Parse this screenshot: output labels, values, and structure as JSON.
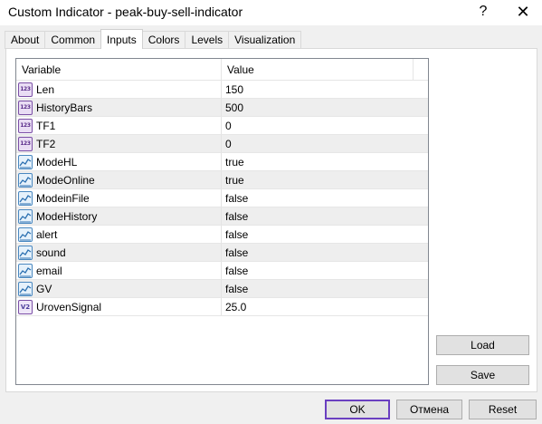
{
  "window": {
    "title": "Custom Indicator - peak-buy-sell-indicator",
    "help_glyph": "?",
    "close_glyph": "✕"
  },
  "tabs": [
    {
      "label": "About"
    },
    {
      "label": "Common"
    },
    {
      "label": "Inputs",
      "active": true
    },
    {
      "label": "Colors"
    },
    {
      "label": "Levels"
    },
    {
      "label": "Visualization"
    }
  ],
  "grid": {
    "header": {
      "variable": "Variable",
      "value": "Value"
    },
    "rows": [
      {
        "icon": "integer-icon",
        "icon_text": "123",
        "name": "Len",
        "value": "150"
      },
      {
        "icon": "integer-icon",
        "icon_text": "123",
        "name": "HistoryBars",
        "value": "500"
      },
      {
        "icon": "integer-icon",
        "icon_text": "123",
        "name": "TF1",
        "value": "0"
      },
      {
        "icon": "integer-icon",
        "icon_text": "123",
        "name": "TF2",
        "value": "0"
      },
      {
        "icon": "boolean-icon",
        "name": "ModeHL",
        "value": "true"
      },
      {
        "icon": "boolean-icon",
        "name": "ModeOnline",
        "value": "true"
      },
      {
        "icon": "boolean-icon",
        "name": "ModeinFile",
        "value": "false"
      },
      {
        "icon": "boolean-icon",
        "name": "ModeHistory",
        "value": "false"
      },
      {
        "icon": "boolean-icon",
        "name": "alert",
        "value": "false"
      },
      {
        "icon": "boolean-icon",
        "name": "sound",
        "value": "false"
      },
      {
        "icon": "boolean-icon",
        "name": "email",
        "value": "false"
      },
      {
        "icon": "boolean-icon",
        "name": "GV",
        "value": "false"
      },
      {
        "icon": "double-icon",
        "icon_text": "V2",
        "name": "UrovenSignal",
        "value": "25.0"
      }
    ]
  },
  "buttons": {
    "load": "Load",
    "save": "Save",
    "ok": "OK",
    "cancel": "Отмена",
    "reset": "Reset"
  },
  "colors": {
    "accent_border": "#6a3fc0",
    "row_alt": "#eeeeee",
    "integer_icon_border": "#7b4fa6",
    "boolean_icon_border": "#4a88c0"
  }
}
